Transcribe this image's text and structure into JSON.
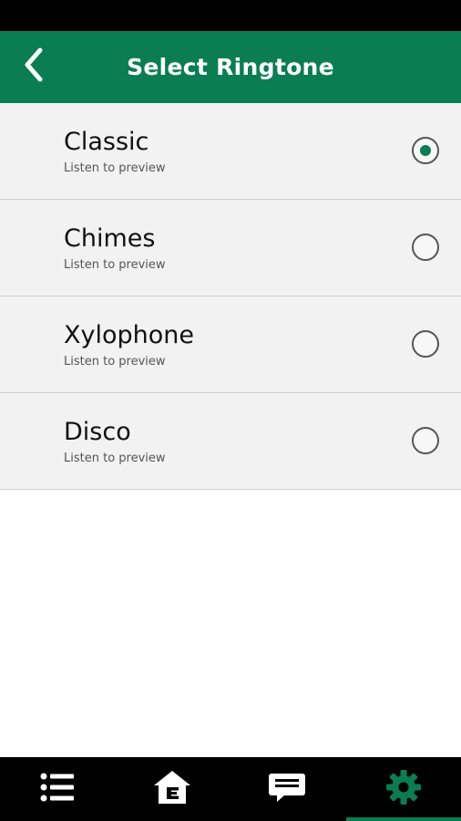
{
  "header": {
    "title": "Select Ringtone",
    "back_icon": "chevron-left-icon"
  },
  "ringtones": [
    {
      "name": "Classic",
      "subtitle": "Listen to preview",
      "selected": true
    },
    {
      "name": "Chimes",
      "subtitle": "Listen to preview",
      "selected": false
    },
    {
      "name": "Xylophone",
      "subtitle": "Listen to preview",
      "selected": false
    },
    {
      "name": "Disco",
      "subtitle": "Listen to preview",
      "selected": false
    }
  ],
  "bottom_nav": {
    "items": [
      {
        "icon": "list-icon",
        "active": false
      },
      {
        "icon": "home-icon",
        "active": false
      },
      {
        "icon": "chat-icon",
        "active": false
      },
      {
        "icon": "gear-icon",
        "active": true
      }
    ]
  },
  "colors": {
    "brand": "#0a7d52",
    "row_background": "#f2f2f2",
    "divider": "#cfcfcf"
  }
}
